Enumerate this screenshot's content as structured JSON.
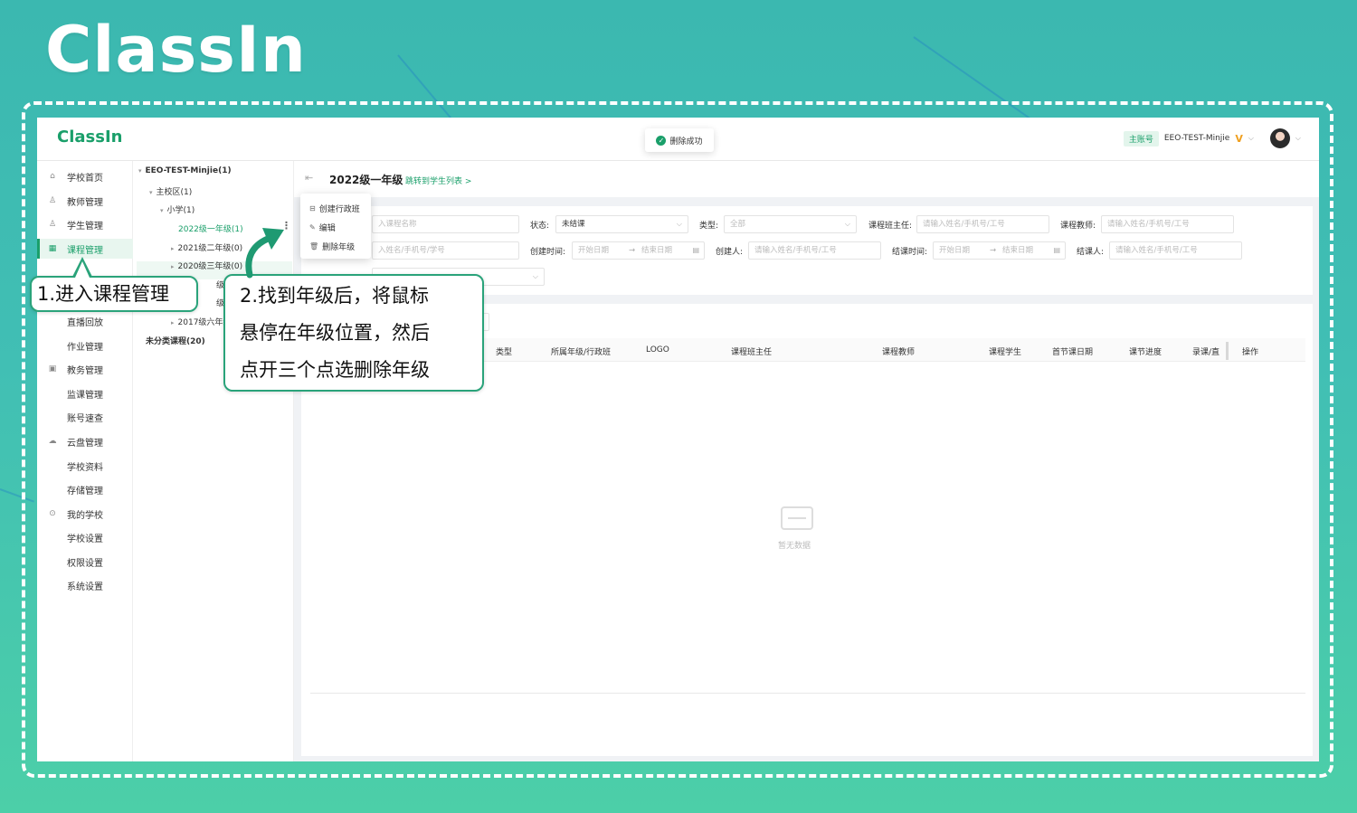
{
  "brand": {
    "logo_text": "ClassIn"
  },
  "app": {
    "logo_text": "ClassIn",
    "toast": "删除成功",
    "account": {
      "badge": "主账号",
      "name": "EEO-TEST-Minjie",
      "vip_mark": "V",
      "chevron": "⌵"
    }
  },
  "sidebar": {
    "items": [
      {
        "label": "学校首页",
        "icon": "home-icon",
        "glyph": "⌂"
      },
      {
        "label": "教师管理",
        "icon": "user-icon",
        "glyph": "♙"
      },
      {
        "label": "学生管理",
        "icon": "users-icon",
        "glyph": "♙"
      },
      {
        "label": "课程管理",
        "icon": "grid-icon",
        "glyph": "▦",
        "active": true
      },
      {
        "label": "直播回放",
        "icon": "",
        "glyph": ""
      },
      {
        "label": "作业管理",
        "icon": "",
        "glyph": ""
      },
      {
        "label": "教务管理",
        "icon": "calendar-icon",
        "glyph": "▣"
      },
      {
        "label": "监课管理",
        "icon": "",
        "glyph": ""
      },
      {
        "label": "账号速查",
        "icon": "",
        "glyph": ""
      },
      {
        "label": "云盘管理",
        "icon": "cloud-icon",
        "glyph": "☁"
      },
      {
        "label": "学校资料",
        "icon": "",
        "glyph": ""
      },
      {
        "label": "存储管理",
        "icon": "",
        "glyph": ""
      },
      {
        "label": "我的学校",
        "icon": "settings-icon",
        "glyph": "⊙"
      },
      {
        "label": "学校设置",
        "icon": "",
        "glyph": ""
      },
      {
        "label": "权限设置",
        "icon": "",
        "glyph": ""
      },
      {
        "label": "系统设置",
        "icon": "",
        "glyph": ""
      }
    ]
  },
  "tree": {
    "root": "EEO-TEST-Minjie(1)",
    "campus": "主校区(1)",
    "school": "小学(1)",
    "grades": [
      "2022级一年级(1)",
      "2021级二年级(0)",
      "2020级三年级(0)",
      "级四年级",
      "级五年级",
      "2017级六年级"
    ],
    "uncategorized": "未分类课程(20)",
    "more": "⋮"
  },
  "context_menu": {
    "items": [
      {
        "label": "创建行政班",
        "glyph": "⊟"
      },
      {
        "label": "编辑",
        "glyph": "✎"
      },
      {
        "label": "删除年级",
        "glyph": "🗑"
      }
    ]
  },
  "header": {
    "back_glyph": "⇤",
    "title": "2022级一年级",
    "jump_link": "跳转到学生列表 >"
  },
  "filters": {
    "course_name_ph": "入课程名称",
    "status_label": "状态:",
    "status_value": "未结课",
    "type_label": "类型:",
    "type_value": "全部",
    "head_teacher_label": "课程班主任:",
    "head_teacher_ph": "请输入姓名/手机号/工号",
    "teacher_label": "课程教师:",
    "teacher_ph": "请输入姓名/手机号/工号",
    "student_ph": "入姓名/手机号/学号",
    "created_time_label": "创建时间:",
    "start_date_ph": "开始日期",
    "arrow": "→",
    "end_date_ph": "结束日期",
    "creator_label": "创建人:",
    "creator_ph": "请输入姓名/手机号/工号",
    "closed_time_label": "结课时间:",
    "closer_label": "结课人:",
    "closer_ph": "请输入姓名/手机号/工号"
  },
  "table": {
    "columns": [
      "类型",
      "所属年级/行政班",
      "LOGO",
      "课程班主任",
      "课程教师",
      "课程学生",
      "首节课日期",
      "课节进度",
      "录课/直",
      "操作"
    ],
    "empty_text": "暂无数据"
  },
  "callouts": {
    "step1": "1.进入课程管理",
    "step2_lines": [
      "2.找到年级后，将鼠标",
      "悬停在年级位置，然后",
      "点开三个点选删除年级"
    ]
  },
  "colors": {
    "brand_green": "#1a9f6a",
    "callout_border": "#2aa37a",
    "background_teal": "#41bfb4"
  }
}
